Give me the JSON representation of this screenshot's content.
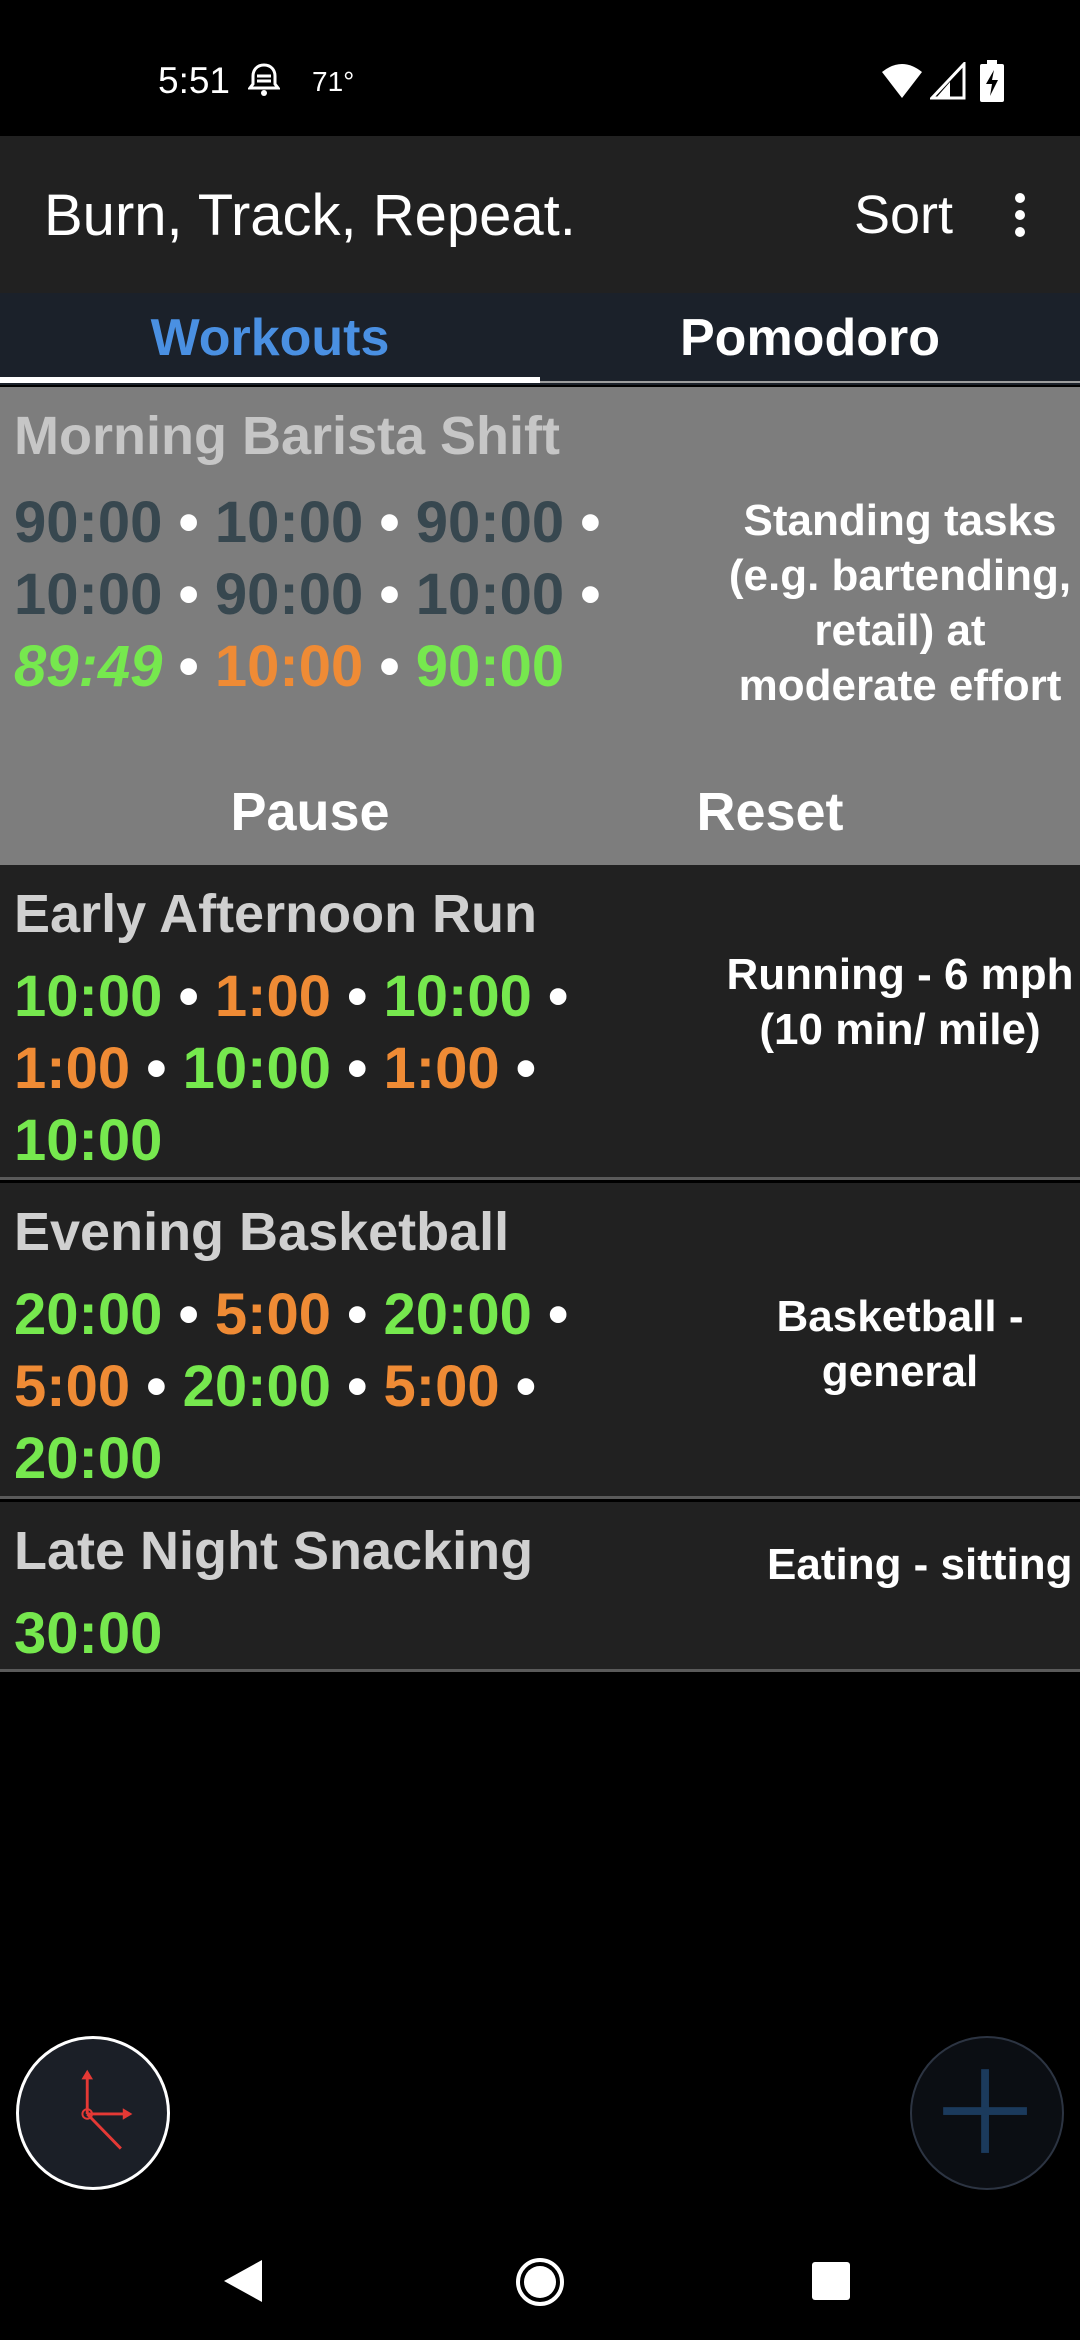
{
  "status_bar": {
    "time": "5:51",
    "temperature": "71°",
    "icons": [
      "notification-icon",
      "wifi-icon",
      "signal-icon",
      "battery-charging-icon"
    ]
  },
  "app_bar": {
    "title": "Burn, Track, Repeat.",
    "sort_label": "Sort",
    "menu_icon": "overflow-menu-icon"
  },
  "tabs": [
    {
      "label": "Workouts",
      "selected": true
    },
    {
      "label": "Pomodoro",
      "selected": false
    }
  ],
  "workouts": [
    {
      "title": "Morning Barista Shift",
      "active": true,
      "intervals": [
        {
          "time": "90:00",
          "state": "done"
        },
        {
          "time": "10:00",
          "state": "done"
        },
        {
          "time": "90:00",
          "state": "done"
        },
        {
          "time": "10:00",
          "state": "done"
        },
        {
          "time": "90:00",
          "state": "done"
        },
        {
          "time": "10:00",
          "state": "done"
        },
        {
          "time": "89:49",
          "state": "active"
        },
        {
          "time": "10:00",
          "state": "rest"
        },
        {
          "time": "90:00",
          "state": "work"
        }
      ],
      "description": "Standing tasks (e.g. bartending, retail) at moderate effort",
      "pause_label": "Pause",
      "reset_label": "Reset"
    },
    {
      "title": "Early Afternoon Run",
      "intervals": [
        {
          "time": "10:00",
          "state": "work"
        },
        {
          "time": "1:00",
          "state": "rest"
        },
        {
          "time": "10:00",
          "state": "work"
        },
        {
          "time": "1:00",
          "state": "rest"
        },
        {
          "time": "10:00",
          "state": "work"
        },
        {
          "time": "1:00",
          "state": "rest"
        },
        {
          "time": "10:00",
          "state": "work"
        }
      ],
      "description": "Running - 6 mph (10 min/ mile)"
    },
    {
      "title": "Evening Basketball",
      "intervals": [
        {
          "time": "20:00",
          "state": "work"
        },
        {
          "time": "5:00",
          "state": "rest"
        },
        {
          "time": "20:00",
          "state": "work"
        },
        {
          "time": "5:00",
          "state": "rest"
        },
        {
          "time": "20:00",
          "state": "work"
        },
        {
          "time": "5:00",
          "state": "rest"
        },
        {
          "time": "20:00",
          "state": "work"
        }
      ],
      "description": "Basketball - general"
    },
    {
      "title": "Late Night Snacking",
      "intervals": [
        {
          "time": "30:00",
          "state": "work"
        }
      ],
      "description": "Eating - sitting"
    }
  ],
  "fabs": {
    "left_icon": "clock-icon",
    "right_icon": "add-icon"
  },
  "nav_bar": {
    "icons": [
      "back-icon",
      "home-icon",
      "recents-icon"
    ]
  },
  "colors": {
    "work": "#76e84e",
    "rest": "#ef8b35",
    "done": "#37474f",
    "tab_selected": "#4a90e2",
    "active_card": "#7d7d7d",
    "card": "#212121"
  }
}
